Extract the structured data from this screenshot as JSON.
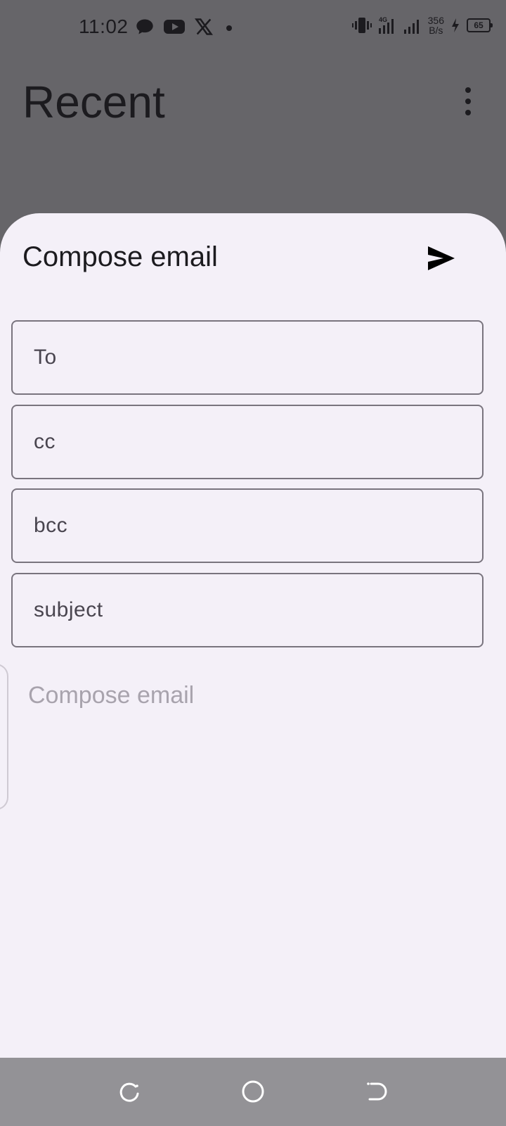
{
  "status_bar": {
    "time": "11:02",
    "net_speed_value": "356",
    "net_speed_unit": "B/s",
    "network_type": "4G",
    "battery_level": "65",
    "icons": [
      "chat-icon",
      "youtube-icon",
      "x-icon",
      "dot-icon",
      "vibrate-icon",
      "signal-4g-icon",
      "signal-icon",
      "charging-icon",
      "battery-icon"
    ]
  },
  "background_app": {
    "title": "Recent",
    "menu_icon": "more-vert-icon"
  },
  "compose_sheet": {
    "title": "Compose email",
    "send_icon": "send-icon",
    "fields": {
      "to_label": "To",
      "cc_label": "cc",
      "bcc_label": "bcc",
      "subject_label": "subject"
    },
    "body_placeholder": "Compose email"
  },
  "nav_bar": {
    "icons": [
      "recents-icon",
      "home-icon",
      "back-icon"
    ]
  },
  "colors": {
    "sheet_background": "#f4f0f8",
    "scrim": "#666569",
    "outline": "#79747e",
    "placeholder": "#a8a3ad",
    "nav_bar": "#939296"
  }
}
